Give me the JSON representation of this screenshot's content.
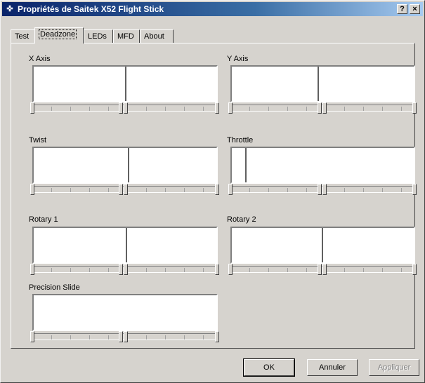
{
  "window": {
    "title": "Propriétés de Saitek X52 Flight Stick",
    "title_buttons": [
      "?",
      "×"
    ]
  },
  "tabs": [
    "Test",
    "Deadzone",
    "LEDs",
    "MFD",
    "About"
  ],
  "active_tab": "Deadzone",
  "axes": {
    "x": {
      "label": "X Axis"
    },
    "y": {
      "label": "Y Axis"
    },
    "twist": {
      "label": "Twist"
    },
    "throttle": {
      "label": "Throttle"
    },
    "rotary1": {
      "label": "Rotary 1"
    },
    "rotary2": {
      "label": "Rotary 2"
    },
    "precision": {
      "label": "Precision Slide"
    }
  },
  "buttons": {
    "ok": "OK",
    "cancel": "Annuler",
    "apply": "Appliquer"
  },
  "icons": {
    "app": "joystick-icon",
    "help": "help-icon",
    "close": "close-icon"
  }
}
